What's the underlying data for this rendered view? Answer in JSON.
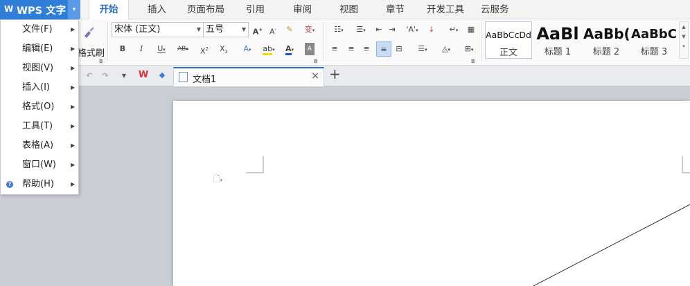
{
  "app": {
    "logo": "W",
    "title": "WPS 文字",
    "caret": "▾"
  },
  "tabs": [
    {
      "label": "开始",
      "active": true
    },
    {
      "label": "插入"
    },
    {
      "label": "页面布局"
    },
    {
      "label": "引用"
    },
    {
      "label": "审阅"
    },
    {
      "label": "视图"
    },
    {
      "label": "章节"
    },
    {
      "label": "开发工具"
    },
    {
      "label": "云服务"
    }
  ],
  "ribbon": {
    "format_painter_label": "格式刷",
    "font_name": "宋体 (正文)",
    "font_size": "五号",
    "styles": [
      {
        "sample": "AaBbCcDd",
        "name": "正文"
      },
      {
        "sample": "AaBl",
        "name": "标题 1"
      },
      {
        "sample": "AaBb(",
        "name": "标题 2"
      },
      {
        "sample": "AaBbC",
        "name": "标题 3"
      }
    ],
    "colors": {
      "highlight": "#f5d90a",
      "font_color": "#1e52d6",
      "accent": "#2b6fc2"
    }
  },
  "menu": {
    "items": [
      {
        "label": "文件(F)"
      },
      {
        "label": "编辑(E)"
      },
      {
        "label": "视图(V)"
      },
      {
        "label": "插入(I)"
      },
      {
        "label": "格式(O)"
      },
      {
        "label": "工具(T)"
      },
      {
        "label": "表格(A)"
      },
      {
        "label": "窗口(W)"
      },
      {
        "label": "帮助(H)",
        "icon": "help-icon"
      }
    ]
  },
  "document": {
    "tab_name": "文档1",
    "new_tab": "+",
    "close": "×"
  }
}
